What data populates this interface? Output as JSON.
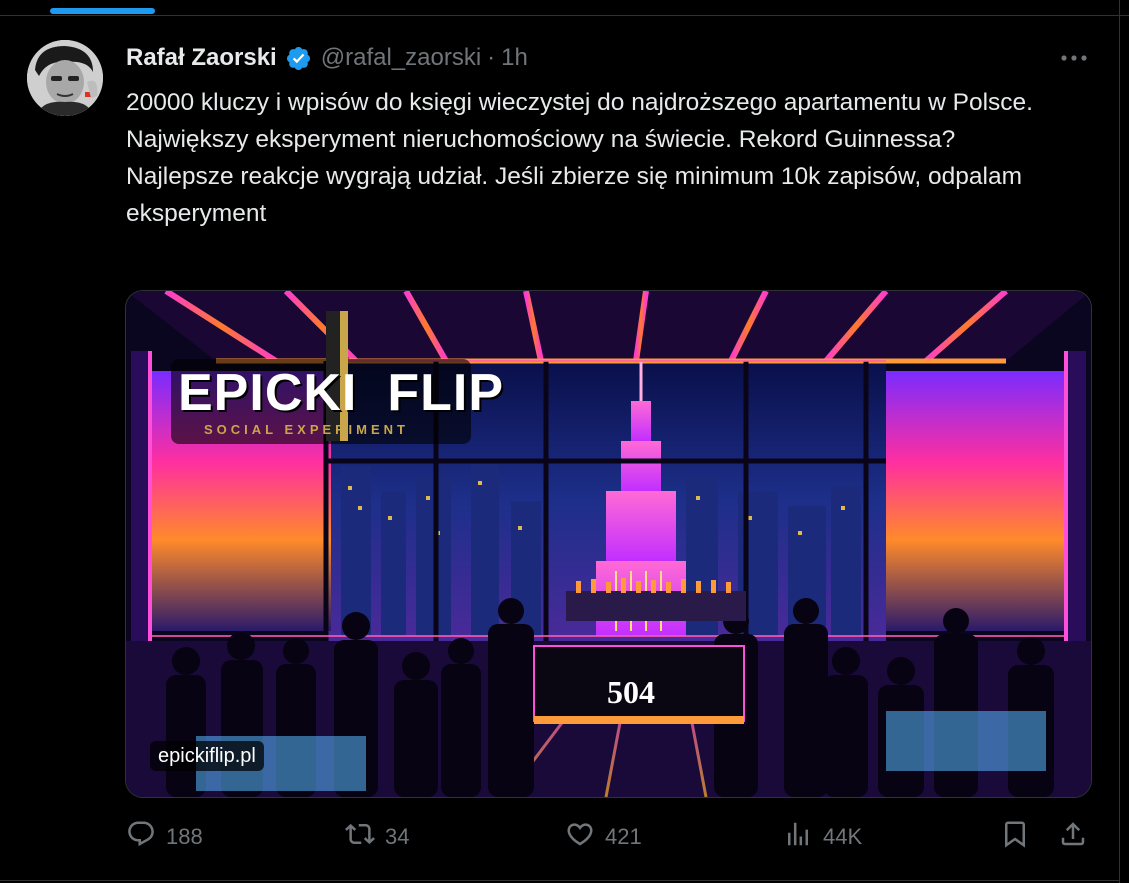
{
  "author": {
    "name": "Rafał Zaorski",
    "handle": "@rafal_zaorski",
    "separator": "·",
    "time": "1h"
  },
  "tweet": {
    "paragraphs": [
      "20000 kluczy i wpisów do księgi wieczystej do najdroższego apartamentu w Polsce. Największy eksperyment nieruchomościowy na świecie. Rekord Guinnessa?",
      "Najlepsze reakcje wygrają udział. Jeśli zbierze się minimum 10k zapisów, odpalam eksperyment"
    ]
  },
  "media": {
    "logo_word1": "EPICKI",
    "logo_word2": "FLIP",
    "logo_tagline": "SOCIAL EXPERIMENT",
    "bar_number": "504",
    "link_label": "epickiflip.pl"
  },
  "actions": {
    "replies": "188",
    "reposts": "34",
    "likes": "421",
    "views": "44K"
  },
  "icons": [
    "verified-badge-icon",
    "more-icon",
    "reply-icon",
    "repost-icon",
    "like-icon",
    "views-icon",
    "bookmark-icon",
    "share-icon"
  ],
  "colors": {
    "accent": "#1d9bf0",
    "background": "#000000",
    "text_primary": "#e7e9ea",
    "text_secondary": "#71767b"
  }
}
